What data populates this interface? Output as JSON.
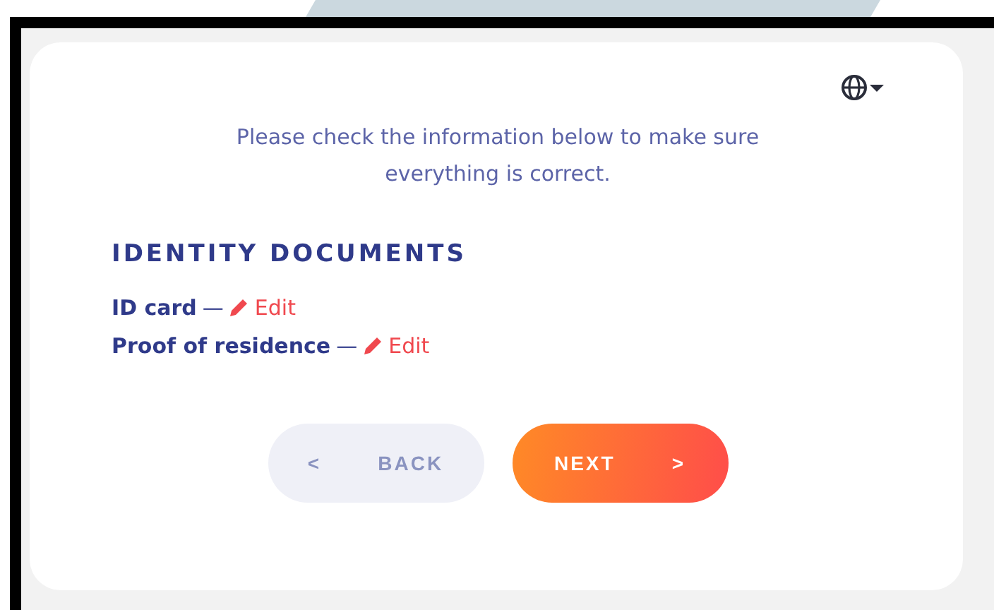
{
  "intro": "Please check the information below to make sure everything is correct.",
  "section": {
    "title": "IDENTITY DOCUMENTS",
    "documents": [
      {
        "name": "ID card",
        "separator": "—",
        "action": "Edit"
      },
      {
        "name": "Proof of residence",
        "separator": "—",
        "action": "Edit"
      }
    ]
  },
  "buttons": {
    "back": {
      "arrow": "<",
      "label": "BACK"
    },
    "next": {
      "label": "NEXT",
      "arrow": ">"
    }
  }
}
